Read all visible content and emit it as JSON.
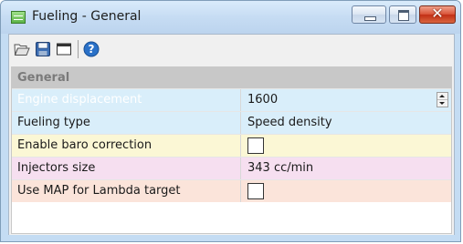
{
  "window": {
    "title": "Fueling - General"
  },
  "toolbar": {
    "icons": [
      "folder-open-icon",
      "save-icon",
      "window-icon",
      "help-icon"
    ],
    "help_glyph": "?"
  },
  "grid": {
    "group_header": "General",
    "rows": [
      {
        "name": "Engine displacement",
        "value": "1600",
        "editor": "spinner",
        "selected": true
      },
      {
        "name": "Fueling type",
        "value": "Speed density",
        "editor": "text"
      },
      {
        "name": "Enable baro correction",
        "value": "",
        "editor": "checkbox",
        "checked": false
      },
      {
        "name": "Injectors size",
        "value": "343 cc/min",
        "editor": "text"
      },
      {
        "name": "Use MAP for Lambda target",
        "value": "",
        "editor": "checkbox",
        "checked": false
      }
    ]
  },
  "colors": {
    "selection": "#0078d7",
    "row_blue": "#d9eefa",
    "row_yellow": "#fbf7d5",
    "row_pink": "#f6dff0",
    "row_peach": "#fbe4da",
    "close_button": "#c22f15"
  }
}
